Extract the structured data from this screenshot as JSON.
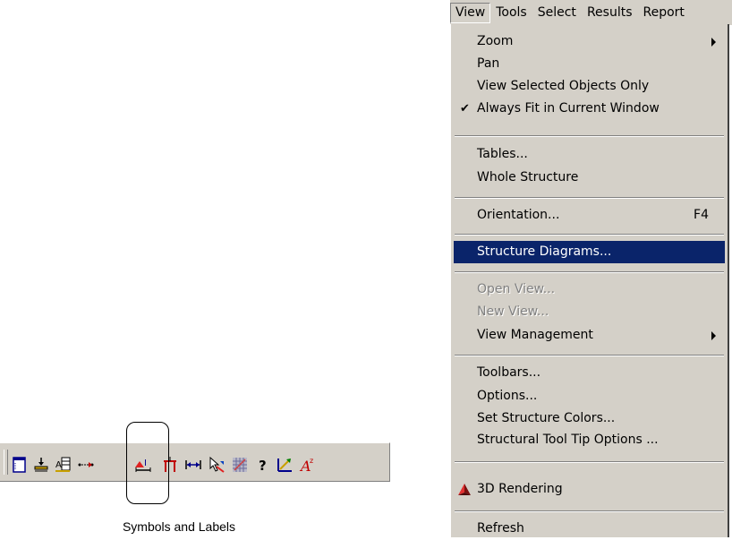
{
  "menubar": {
    "items": [
      "View",
      "Tools",
      "Select",
      "Results",
      "Report"
    ]
  },
  "view_menu": {
    "zoom": "Zoom",
    "pan": "Pan",
    "view_selected_objects_only": "View Selected Objects Only",
    "always_fit": "Always Fit in Current Window",
    "always_fit_checked": true,
    "tables": "Tables...",
    "whole_structure": "Whole Structure",
    "orientation": "Orientation...",
    "orientation_shortcut": "F4",
    "structure_diagrams": "Structure Diagrams...",
    "open_view": "Open View...",
    "new_view": "New View...",
    "view_management": "View Management",
    "toolbars": "Toolbars...",
    "options": "Options...",
    "set_structure_colors": "Set Structure Colors...",
    "structural_tool_tip_options": "Structural Tool Tip Options ...",
    "rendering_3d": "3D Rendering",
    "refresh": "Refresh"
  },
  "toolbar": {
    "caption": "Symbols and Labels",
    "buttons": [
      "window-icon",
      "beam-load-icon",
      "label-table-icon",
      "dimension-dots-icon",
      "symbols-labels-icon",
      "support-icon",
      "dimension-icon",
      "cursor-node-icon",
      "grid-pattern-icon",
      "help-icon",
      "design-icon",
      "font-icon"
    ]
  },
  "colors": {
    "menu_bg": "#d4d0c8",
    "highlight": "#0a246a",
    "disabled_text": "#808080"
  }
}
